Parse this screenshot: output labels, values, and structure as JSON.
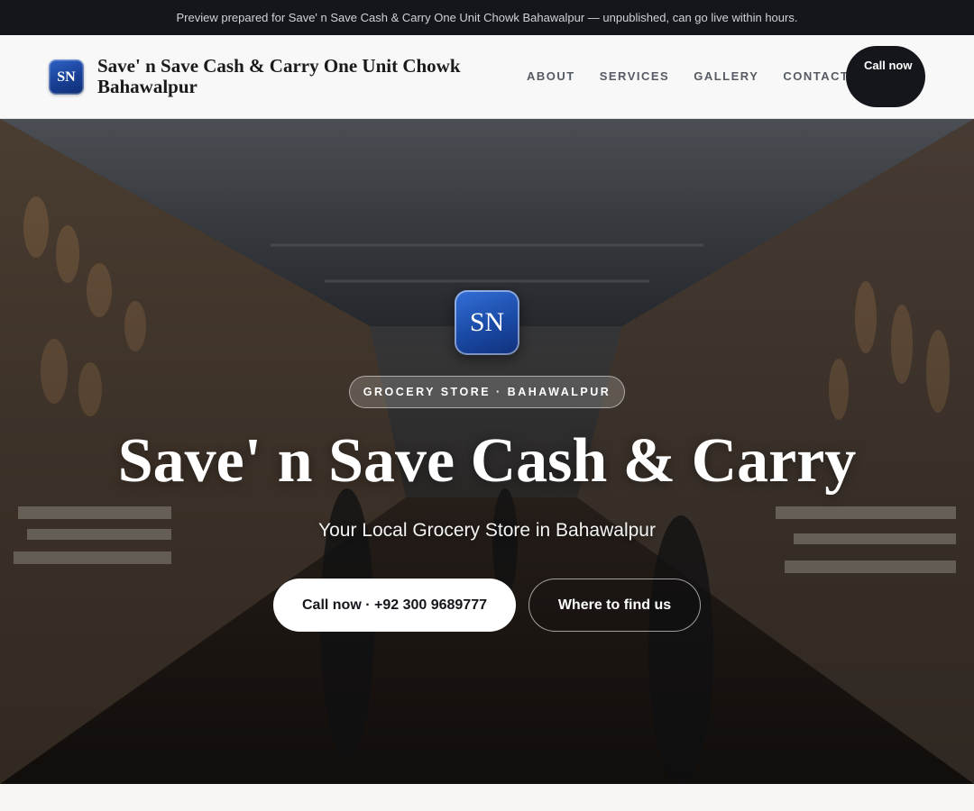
{
  "topbar": {
    "notice": "Preview prepared for Save' n Save Cash & Carry One Unit Chowk Bahawalpur — unpublished, can go live within hours."
  },
  "header": {
    "logo_initials": "SN",
    "brand_name": "Save' n Save Cash & Carry One Unit Chowk Bahawalpur",
    "nav": [
      {
        "label": "ABOUT"
      },
      {
        "label": "SERVICES"
      },
      {
        "label": "GALLERY"
      },
      {
        "label": "CONTACT"
      }
    ],
    "call_button": "Call now"
  },
  "hero": {
    "logo_initials": "SN",
    "tag": "GROCERY STORE · BAHAWALPUR",
    "title": "Save' n Save Cash & Carry",
    "subtitle": "Your Local Grocery Store in Bahawalpur",
    "primary_button": "Call now · +92 300 9689777",
    "secondary_button": "Where to find us"
  },
  "colors": {
    "dark": "#14161b",
    "logo_blue": "#1a4aa6",
    "page_bg": "#f7f6f2"
  }
}
